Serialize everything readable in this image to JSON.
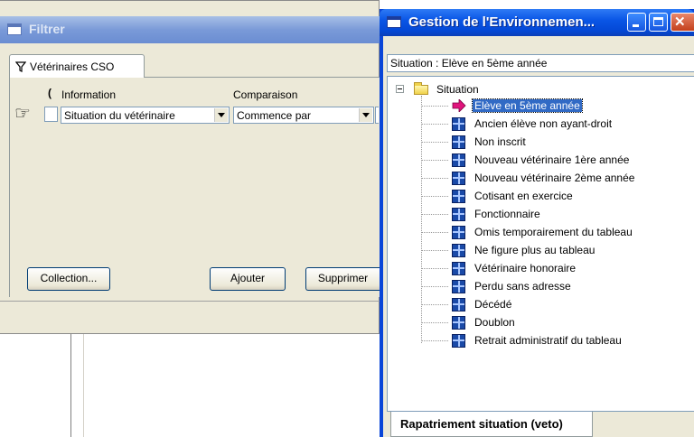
{
  "filter_window": {
    "title": "Filtrer",
    "tab_label": "Vétérinaires CSO",
    "columns": {
      "paren": "(",
      "information": "Information",
      "comparison": "Comparaison"
    },
    "row": {
      "information_value": "Situation du vétérinaire",
      "comparison_value": "Commence par"
    },
    "buttons": {
      "collection": "Collection...",
      "ajouter": "Ajouter",
      "supprimer": "Supprimer"
    }
  },
  "gestion_window": {
    "title": "Gestion de l'Environnemen...",
    "situation_label": "Situation : Elève en 5ème année",
    "tree": {
      "root": "Situation",
      "items": [
        "Elève en 5ème année",
        "Ancien élève non ayant-droit",
        "Non inscrit",
        "Nouveau vétérinaire 1ère année",
        "Nouveau vétérinaire 2ème année",
        "Cotisant en exercice",
        "Fonctionnaire",
        "Omis temporairement du tableau",
        "Ne figure plus au tableau",
        "Vétérinaire honoraire",
        "Perdu sans adresse",
        "Décédé",
        "Doublon",
        "Retrait administratif du tableau"
      ],
      "selected_index": 0
    },
    "bottom_tab": "Rapatriement situation (veto)"
  },
  "colors": {
    "xp_blue": "#0a46d8",
    "face": "#ece9d8",
    "selection": "#316ac5",
    "arrow": "#e0147c"
  }
}
